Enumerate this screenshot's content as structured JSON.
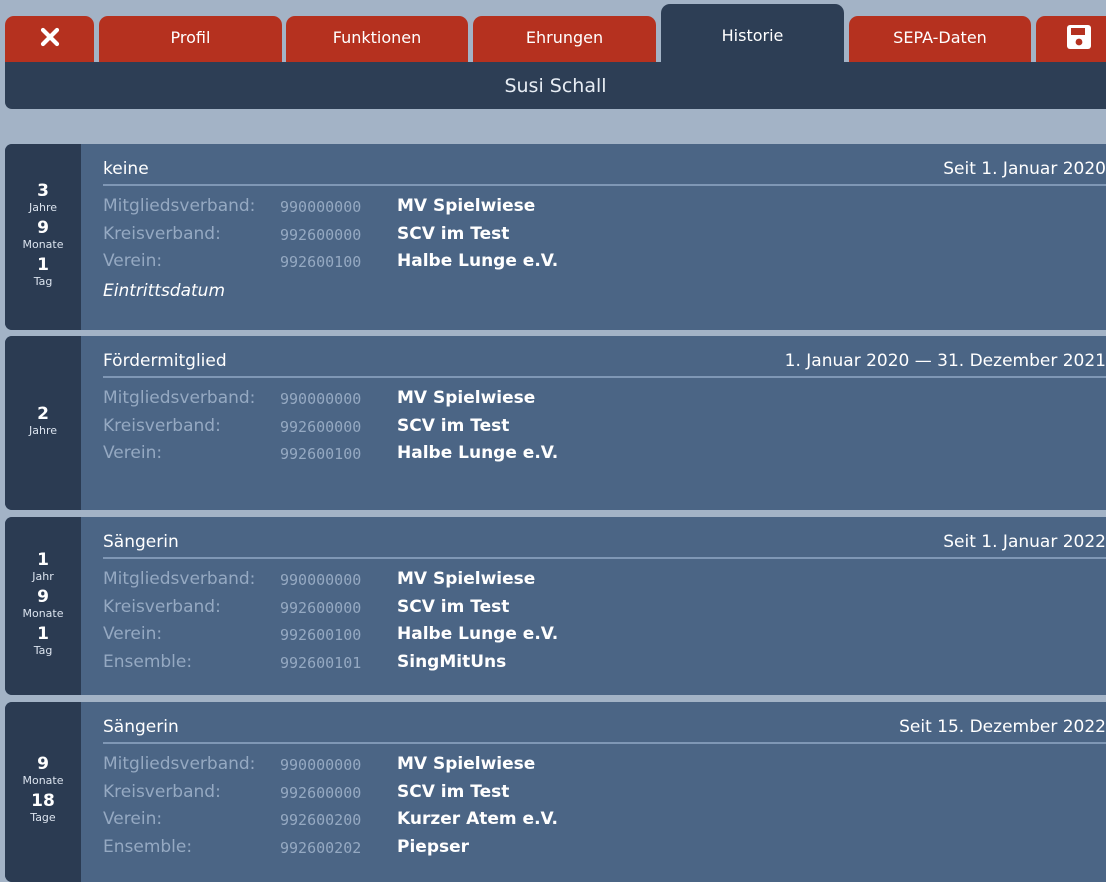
{
  "tabs": {
    "close_icon": "close-icon",
    "items": [
      {
        "label": "Profil"
      },
      {
        "label": "Funktionen"
      },
      {
        "label": "Ehrungen"
      },
      {
        "label": "Historie",
        "active": true
      },
      {
        "label": "SEPA-Daten"
      }
    ],
    "save_icon": "save-icon"
  },
  "header": {
    "title": "Susi Schall"
  },
  "cards": [
    {
      "duration": [
        {
          "num": "3",
          "unit": "Jahre"
        },
        {
          "num": "9",
          "unit": "Monate"
        },
        {
          "num": "1",
          "unit": "Tag"
        }
      ],
      "role": "keine",
      "date": "Seit 1. Januar 2020",
      "rows": [
        {
          "label": "Mitgliedsverband:",
          "code": "990000000",
          "name": "MV Spielwiese"
        },
        {
          "label": "Kreisverband:",
          "code": "992600000",
          "name": "SCV im Test"
        },
        {
          "label": "Verein:",
          "code": "992600100",
          "name": "Halbe Lunge e.V."
        }
      ],
      "note": "Eintrittsdatum"
    },
    {
      "duration": [
        {
          "num": "2",
          "unit": "Jahre"
        }
      ],
      "role": "Fördermitglied",
      "date": "1. Januar 2020 — 31. Dezember 2021",
      "rows": [
        {
          "label": "Mitgliedsverband:",
          "code": "990000000",
          "name": "MV Spielwiese"
        },
        {
          "label": "Kreisverband:",
          "code": "992600000",
          "name": "SCV im Test"
        },
        {
          "label": "Verein:",
          "code": "992600100",
          "name": "Halbe Lunge e.V."
        }
      ]
    },
    {
      "duration": [
        {
          "num": "1",
          "unit": "Jahr"
        },
        {
          "num": "9",
          "unit": "Monate"
        },
        {
          "num": "1",
          "unit": "Tag"
        }
      ],
      "role": "Sängerin",
      "date": "Seit 1. Januar 2022",
      "rows": [
        {
          "label": "Mitgliedsverband:",
          "code": "990000000",
          "name": "MV Spielwiese"
        },
        {
          "label": "Kreisverband:",
          "code": "992600000",
          "name": "SCV im Test"
        },
        {
          "label": "Verein:",
          "code": "992600100",
          "name": "Halbe Lunge e.V."
        },
        {
          "label": "Ensemble:",
          "code": "992600101",
          "name": "SingMitUns"
        }
      ]
    },
    {
      "duration": [
        {
          "num": "9",
          "unit": "Monate"
        },
        {
          "num": "18",
          "unit": "Tage"
        }
      ],
      "role": "Sängerin",
      "date": "Seit 15. Dezember 2022",
      "rows": [
        {
          "label": "Mitgliedsverband:",
          "code": "990000000",
          "name": "MV Spielwiese"
        },
        {
          "label": "Kreisverband:",
          "code": "992600000",
          "name": "SCV im Test"
        },
        {
          "label": "Verein:",
          "code": "992600200",
          "name": "Kurzer Atem e.V."
        },
        {
          "label": "Ensemble:",
          "code": "992600202",
          "name": "Piepser"
        }
      ]
    }
  ]
}
